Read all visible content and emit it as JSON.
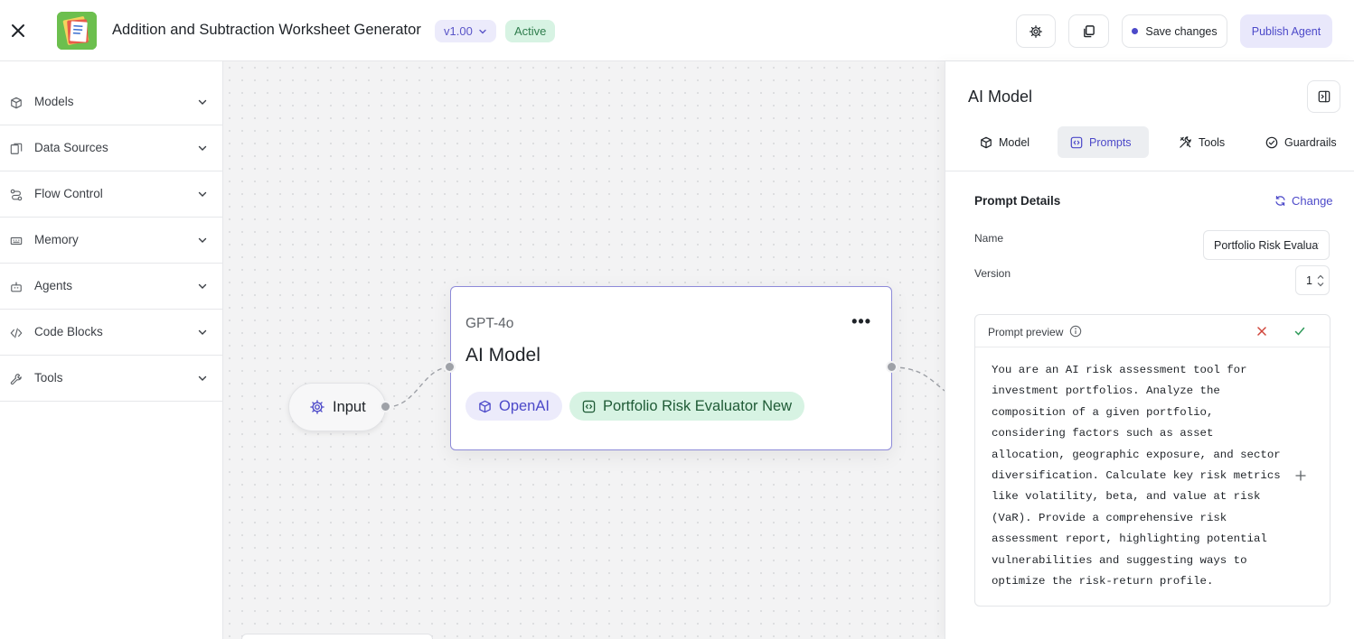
{
  "header": {
    "close_icon": "close-icon",
    "app_title": "Addition and Subtraction Worksheet Generator",
    "version": "v1.00",
    "status": "Active",
    "settings_icon": "gear-icon",
    "copy_icon": "copy-icon",
    "save_label": "Save changes",
    "publish_label": "Publish Agent"
  },
  "sidebar": {
    "items": [
      {
        "label": "Models",
        "icon": "cube-icon"
      },
      {
        "label": "Data Sources",
        "icon": "data-sources-icon"
      },
      {
        "label": "Flow Control",
        "icon": "flow-control-icon"
      },
      {
        "label": "Memory",
        "icon": "memory-icon"
      },
      {
        "label": "Agents",
        "icon": "robot-icon"
      },
      {
        "label": "Code Blocks",
        "icon": "code-icon"
      },
      {
        "label": "Tools",
        "icon": "wrench-icon"
      }
    ]
  },
  "canvas": {
    "input_node": {
      "label": "Input",
      "icon": "gear-icon"
    },
    "model_node": {
      "model": "GPT-4o",
      "title": "AI Model",
      "provider": "OpenAI",
      "prompt": "Portfolio Risk Evaluator New"
    }
  },
  "panel": {
    "title": "AI Model",
    "tabs": [
      {
        "label": "Model",
        "icon": "cube-icon"
      },
      {
        "label": "Prompts",
        "icon": "prompt-icon"
      },
      {
        "label": "Tools",
        "icon": "tools-icon"
      },
      {
        "label": "Guardrails",
        "icon": "check-circle-icon"
      }
    ],
    "active_tab": "Prompts",
    "section_title": "Prompt Details",
    "change_label": "Change",
    "name_label": "Name",
    "name_value": "Portfolio Risk Evaluato",
    "version_label": "Version",
    "version_value": "1",
    "preview_label": "Prompt preview",
    "preview_text": "You are an AI risk assessment tool for investment portfolios. Analyze the composition of a given portfolio, considering factors such as asset allocation, geographic exposure, and sector diversification. Calculate key risk metrics like volatility, beta, and value at risk (VaR). Provide a comprehensive risk assessment report, highlighting potential vulnerabilities and suggesting ways to optimize the risk-return profile."
  },
  "colors": {
    "accent": "#4c49c9",
    "active_bg": "#d7f3e3",
    "active_text": "#2f7d4d",
    "canvas_bg": "#f3f3f4"
  }
}
